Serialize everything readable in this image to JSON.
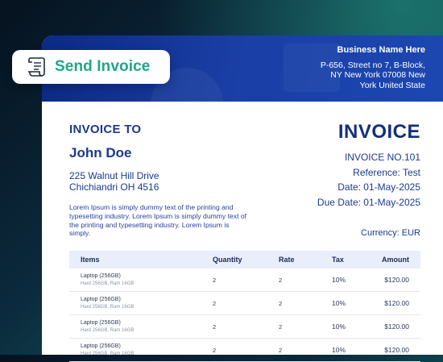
{
  "badge": {
    "label": "Send Invoice",
    "icon": "document-scroll-icon"
  },
  "business": {
    "name": "Business Name Here",
    "address_lines": [
      "P-656, Street no 7, B-Block,",
      "NY New York 07008 New",
      "York United State"
    ]
  },
  "invoice_to": {
    "heading": "INVOICE TO",
    "client_name": "John Doe",
    "address_lines": [
      "225 Walnut Hill Drive",
      "Chichiandri OH 4516"
    ],
    "note": "Lorem Ipsum is simply dummy text of the printing and typesetting industry. Lorem Ipsum is simply dummy text of the printing and typesetting industry. Lorem Ipsum is simply."
  },
  "invoice": {
    "title": "INVOICE",
    "number": "INVOICE NO.101",
    "reference": "Reference: Test",
    "date": "Date: 01-May-2025",
    "due_date": "Due Date: 01-May-2025",
    "currency": "Currency: EUR"
  },
  "table": {
    "headers": [
      "Items",
      "Quantity",
      "Rate",
      "Tax",
      "Amount"
    ],
    "rows": [
      {
        "name": "Laptop (256GB)",
        "desc": "Hard 256GB, Ram 16GB",
        "qty": "2",
        "rate": "2",
        "tax": "10%",
        "amount": "$120.00"
      },
      {
        "name": "Laptop (256GB)",
        "desc": "Hard 256GB, Ram 16GB",
        "qty": "2",
        "rate": "2",
        "tax": "10%",
        "amount": "$120.00"
      },
      {
        "name": "Laptop (256GB)",
        "desc": "Hard 256GB, Ram 16GB",
        "qty": "2",
        "rate": "2",
        "tax": "10%",
        "amount": "$120.00"
      },
      {
        "name": "Laptop (256GB)",
        "desc": "Hard 256GB, Ram 16GB",
        "qty": "2",
        "rate": "2",
        "tax": "10%",
        "amount": "$120.00"
      }
    ]
  },
  "colors": {
    "accent_green": "#1fa58a",
    "header_blue": "#1a3fa6",
    "text_navy": "#1b3a8c"
  }
}
